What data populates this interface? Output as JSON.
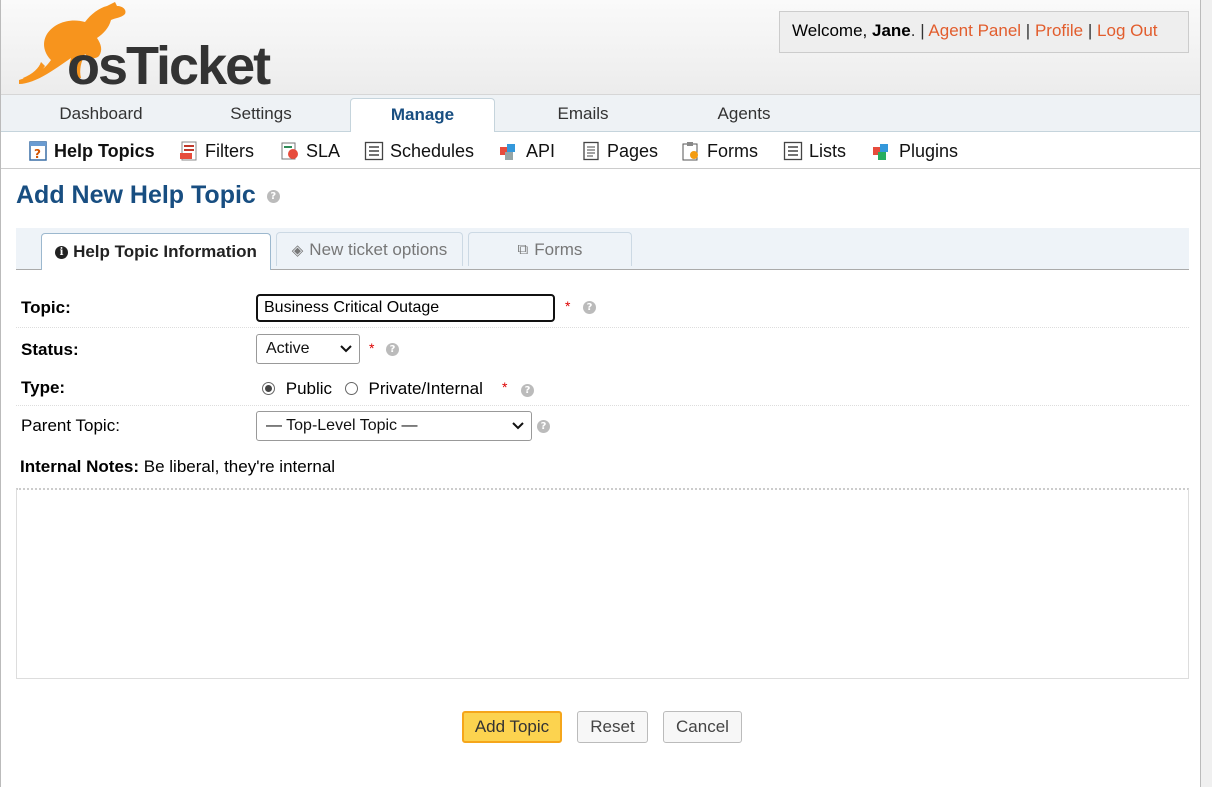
{
  "app": {
    "logo_text": "osTicket"
  },
  "user": {
    "welcome_prefix": "Welcome, ",
    "name": "Jane",
    "welcome_suffix": ". |",
    "links": [
      "Agent Panel",
      "Profile",
      "Log Out"
    ]
  },
  "nav": {
    "tabs": [
      "Dashboard",
      "Settings",
      "Manage",
      "Emails",
      "Agents"
    ],
    "active": "Manage"
  },
  "subnav": {
    "items": [
      "Help Topics",
      "Filters",
      "SLA",
      "Schedules",
      "API",
      "Pages",
      "Forms",
      "Lists",
      "Plugins"
    ],
    "active": "Help Topics"
  },
  "page": {
    "title": "Add New Help Topic"
  },
  "form_tabs": {
    "items": [
      "Help Topic Information",
      "New ticket options",
      "Forms"
    ],
    "active": "Help Topic Information"
  },
  "form": {
    "topic": {
      "label": "Topic:",
      "value": "Business Critical Outage",
      "required": "*"
    },
    "status": {
      "label": "Status:",
      "value": "Active",
      "required": "*"
    },
    "type": {
      "label": "Type:",
      "options": [
        "Public",
        "Private/Internal"
      ],
      "selected": "Public",
      "required": "*"
    },
    "parent_topic": {
      "label": "Parent Topic:",
      "value": "— Top-Level Topic —"
    },
    "internal_notes": {
      "label": "Internal Notes:",
      "hint": "Be liberal, they're internal",
      "value": ""
    }
  },
  "buttons": {
    "submit": "Add Topic",
    "reset": "Reset",
    "cancel": "Cancel"
  },
  "colors": {
    "brand_orange": "#f7941d",
    "title_blue": "#184e81",
    "link_orange": "#e25d2d",
    "required_red": "#dd0000",
    "primary_button": "#fcd34f"
  }
}
